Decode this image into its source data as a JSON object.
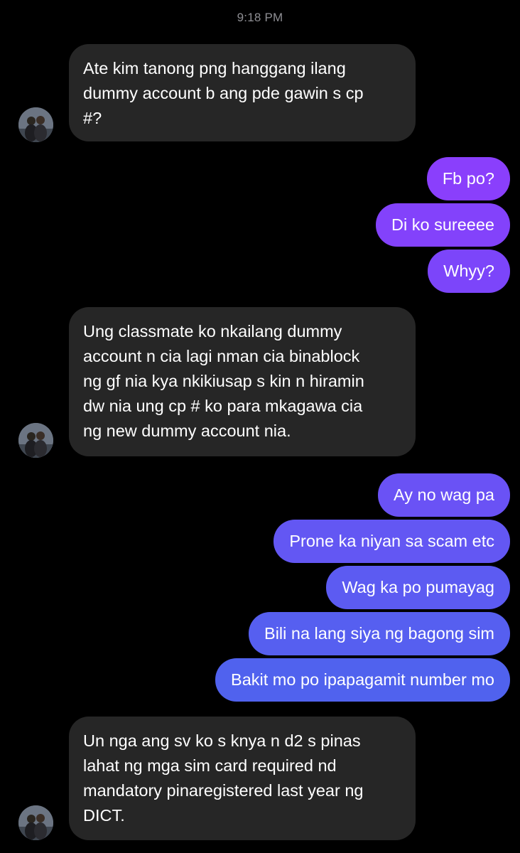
{
  "header": {
    "time": "9:18 PM"
  },
  "messages": {
    "m1": {
      "sender": "other",
      "lines": [
        "Ate kim tanong png hanggang ilang",
        "dummy account b ang pde gawin s cp",
        "#?"
      ]
    },
    "m2": {
      "sender": "me",
      "text": "Fb po?"
    },
    "m3": {
      "sender": "me",
      "text": "Di ko sureeee"
    },
    "m4": {
      "sender": "me",
      "text": "Whyy?"
    },
    "m5": {
      "sender": "other",
      "lines": [
        "Ung classmate ko nkailang dummy",
        "account n cia lagi nman cia binablock",
        "ng gf nia kya nkikiusap s kin n hiramin",
        "dw nia ung cp # ko para mkagawa cia",
        "ng new dummy account nia."
      ]
    },
    "m6": {
      "sender": "me",
      "text": "Ay no wag pa"
    },
    "m7": {
      "sender": "me",
      "text": "Prone ka niyan sa scam etc"
    },
    "m8": {
      "sender": "me",
      "text": "Wag ka po pumayag"
    },
    "m9": {
      "sender": "me",
      "text": "Bili na lang siya ng bagong sim"
    },
    "m10": {
      "sender": "me",
      "text": "Bakit mo po ipapagamit number mo"
    },
    "m11": {
      "sender": "other",
      "lines": [
        "Un nga ang sv ko s knya n d2 s pinas",
        "lahat ng mga sim card required nd",
        "mandatory pinaregistered last year ng",
        "DICT."
      ]
    }
  },
  "colors": {
    "background": "#000000",
    "incoming_bubble": "#262626",
    "outgoing_gradient": [
      "#8a3ffc",
      "#7a46f8",
      "#6654f4",
      "#5b5cf2",
      "#4f62ee"
    ],
    "timestamp": "#8e8e93"
  },
  "icons": {
    "avatar": "contact-avatar-photo"
  }
}
